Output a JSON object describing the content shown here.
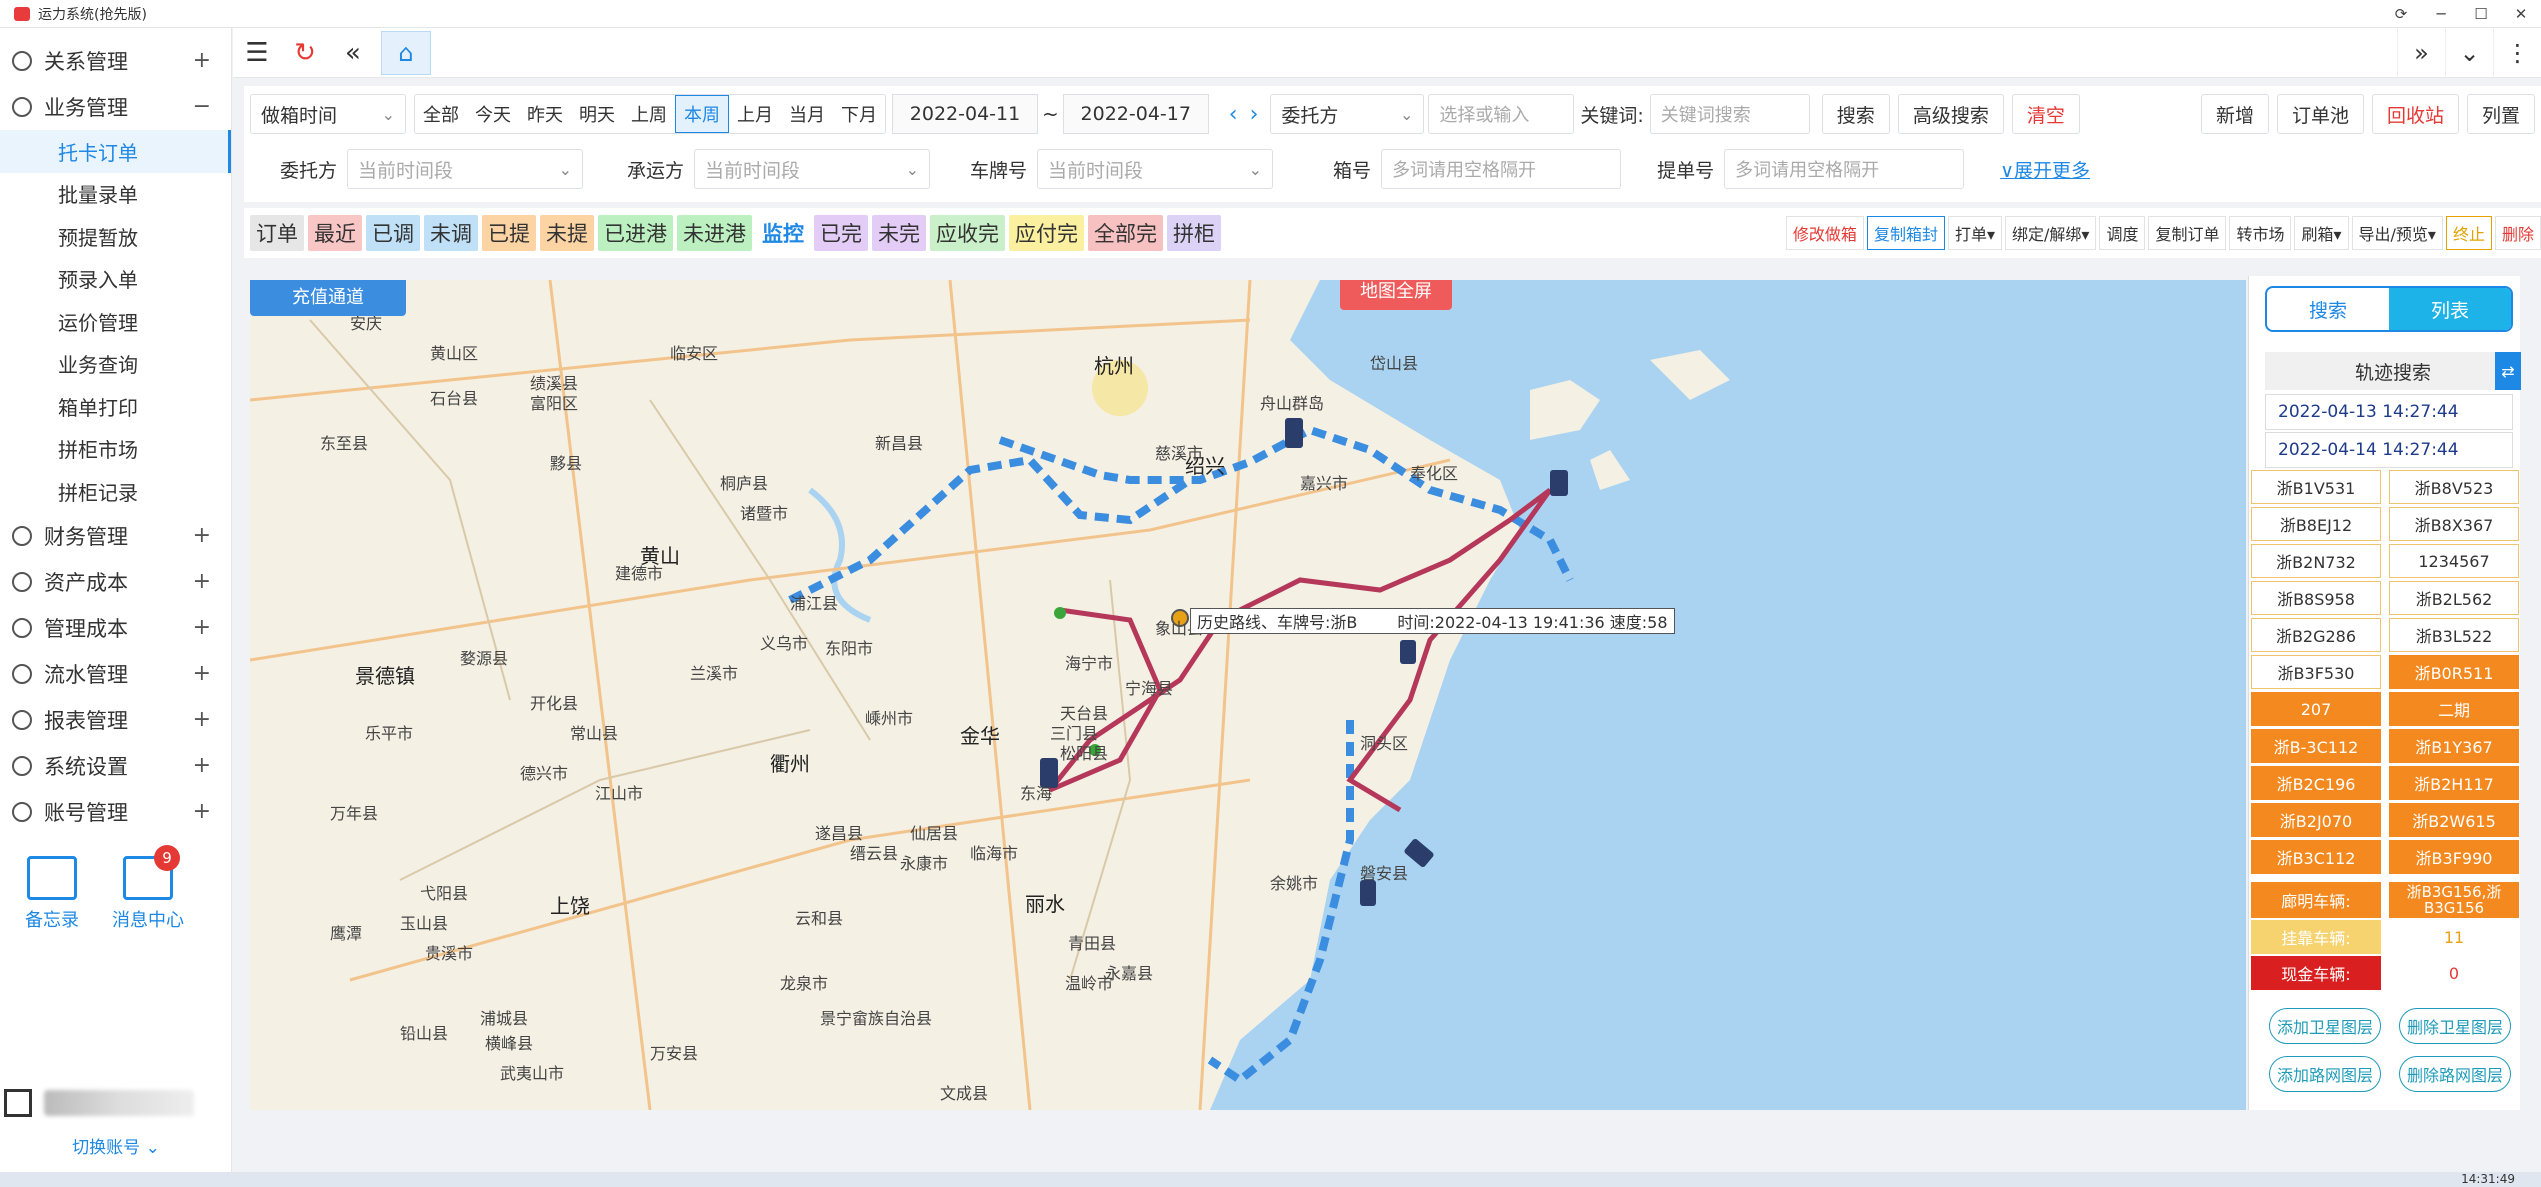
{
  "window": {
    "title": "运力系统(抢先版)"
  },
  "sidebar": {
    "groups_top": [
      {
        "label": "关系管理",
        "sign": "+"
      },
      {
        "label": "业务管理",
        "sign": "−"
      }
    ],
    "sub": [
      "托卡订单",
      "批量录单",
      "预提暂放",
      "预录入单",
      "运价管理",
      "业务查询",
      "箱单打印",
      "拼柜市场",
      "拼柜记录"
    ],
    "groups_bottom": [
      {
        "label": "财务管理",
        "sign": "+"
      },
      {
        "label": "资产成本",
        "sign": "+"
      },
      {
        "label": "管理成本",
        "sign": "+"
      },
      {
        "label": "流水管理",
        "sign": "+"
      },
      {
        "label": "报表管理",
        "sign": "+"
      },
      {
        "label": "系统设置",
        "sign": "+"
      },
      {
        "label": "账号管理",
        "sign": "+"
      }
    ],
    "memo": "备忘录",
    "messages": "消息中心",
    "msg_count": "9",
    "switch_account": "切换账号"
  },
  "filter": {
    "time_type": "做箱时间",
    "ranges": [
      "全部",
      "今天",
      "昨天",
      "明天",
      "上周",
      "本周",
      "上月",
      "当月",
      "下月"
    ],
    "active_range": "本周",
    "date_from": "2022-04-11",
    "tilde": "~",
    "date_to": "2022-04-17",
    "party_select": "委托方",
    "party_placeholder": "选择或输入",
    "keyword_label": "关键词:",
    "keyword_placeholder": "关键词搜索",
    "search": "搜索",
    "advanced": "高级搜索",
    "clear": "清空",
    "new": "新增",
    "order_pool": "订单池",
    "recycle": "回收站",
    "columns": "列置",
    "client_label": "委托方",
    "client_placeholder": "当前时间段",
    "carrier_label": "承运方",
    "carrier_placeholder": "当前时间段",
    "plate_label": "车牌号",
    "plate_placeholder": "当前时间段",
    "box_label": "箱号",
    "box_placeholder": "多词请用空格隔开",
    "bill_label": "提单号",
    "bill_placeholder": "多词请用空格隔开",
    "expand": "展开更多"
  },
  "status_tabs": [
    {
      "label": "订单",
      "bg": "#e6e6e6",
      "fg": "#333"
    },
    {
      "label": "最近",
      "bg": "#f9c6c6",
      "fg": "#333"
    },
    {
      "label": "已调",
      "bg": "#bfe0f7",
      "fg": "#333"
    },
    {
      "label": "未调",
      "bg": "#bfe0f7",
      "fg": "#333"
    },
    {
      "label": "已提",
      "bg": "#fcd3a3",
      "fg": "#333"
    },
    {
      "label": "未提",
      "bg": "#fcd3a3",
      "fg": "#333"
    },
    {
      "label": "已进港",
      "bg": "#bdf0c0",
      "fg": "#333"
    },
    {
      "label": "未进港",
      "bg": "#bdf0c0",
      "fg": "#333"
    },
    {
      "label": "监控",
      "bg": "#ffffff",
      "fg": "#1e88e5"
    },
    {
      "label": "已完",
      "bg": "#e3cdf7",
      "fg": "#333"
    },
    {
      "label": "未完",
      "bg": "#e3cdf7",
      "fg": "#333"
    },
    {
      "label": "应收完",
      "bg": "#c9f0c9",
      "fg": "#333"
    },
    {
      "label": "应付完",
      "bg": "#faf0a0",
      "fg": "#333"
    },
    {
      "label": "全部完",
      "bg": "#f7c1c1",
      "fg": "#333"
    },
    {
      "label": "拼柜",
      "bg": "#dcd2f5",
      "fg": "#333"
    }
  ],
  "actions": [
    "修改做箱",
    "复制箱封",
    "打单▾",
    "绑定/解绑▾",
    "调度",
    "复制订单",
    "转市场",
    "刷箱▾",
    "导出/预览▾",
    "终止",
    "删除"
  ],
  "map": {
    "recharge": "充值通道",
    "fullscreen": "地图全屏",
    "tooltip_route": "历史路线、车牌号:浙B",
    "tooltip_info": "时间:2022-04-13 19:41:36 速度:58",
    "cities_big": [
      "杭州",
      "黄山",
      "金华",
      "衢州",
      "丽水",
      "绍兴",
      "上饶",
      "景德镇"
    ],
    "cities": [
      "安庆",
      "石台县",
      "东至县",
      "黟县",
      "黄山区",
      "绩溪县",
      "临安区",
      "富阳区",
      "桐庐县",
      "诸暨市",
      "建德市",
      "浦江县",
      "东阳市",
      "兰溪市",
      "义乌市",
      "开化县",
      "常山县",
      "江山市",
      "德兴市",
      "婺源县",
      "乐平市",
      "万年县",
      "鹰潭",
      "龙泉市",
      "云和县",
      "遂昌县",
      "缙云县",
      "永康市",
      "仙居县",
      "临海市",
      "温岭市",
      "文成县",
      "青田县",
      "永嘉县",
      "景宁畲族自治县",
      "浦城县",
      "武夷山市",
      "宁海县",
      "象山县",
      "舟山群岛",
      "岱山县",
      "慈溪市",
      "海宁市",
      "天台县",
      "三门县",
      "东海",
      "嵊州市",
      "新昌县",
      "奉化区",
      "松阳县",
      "余姚市",
      "磐安县",
      "洞头区",
      "嘉兴市",
      "玉山县",
      "铅山县",
      "弋阳县",
      "贵溪市",
      "横峰县",
      "万安县"
    ]
  },
  "right_panel": {
    "tab_search": "搜索",
    "tab_list": "列表",
    "track_title": "轨迹搜索",
    "start_time": "2022-04-13 14:27:44",
    "end_time": "2022-04-14 14:27:44",
    "vehicles": [
      [
        "浙B1V531",
        "浙B8V523"
      ],
      [
        "浙B8EJ12",
        "浙B8X367"
      ],
      [
        "浙B2N732",
        "1234567"
      ],
      [
        "浙B8S958",
        "浙B2L562"
      ],
      [
        "浙B2G286",
        "浙B3L522"
      ],
      [
        "浙B3F530",
        "浙B0R511"
      ],
      [
        "207",
        "二期"
      ],
      [
        "浙B-3C112",
        "浙B1Y367"
      ],
      [
        "浙B2C196",
        "浙B2H117"
      ],
      [
        "浙B2J070",
        "浙B2W615"
      ],
      [
        "浙B3C112",
        "浙B3F990"
      ]
    ],
    "truck_label": "廊明车辆:",
    "truck_value": "浙B3G156,浙B3G156",
    "attach_label": "挂靠车辆:",
    "attach_value": "11",
    "cash_label": "现金车辆:",
    "cash_value": "0",
    "add_sat": "添加卫星图层",
    "del_sat": "删除卫星图层",
    "add_road": "添加路网图层",
    "del_road": "删除路网图层"
  },
  "taskbar": {
    "clock": "14:31:49"
  }
}
